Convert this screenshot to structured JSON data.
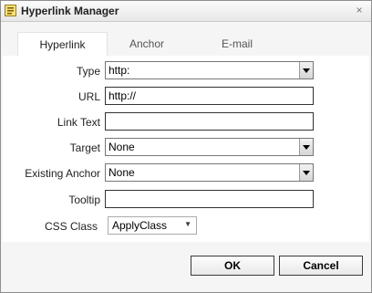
{
  "window": {
    "title": "Hyperlink Manager",
    "close_glyph": "×"
  },
  "tabs": [
    {
      "label": "Hyperlink",
      "active": true
    },
    {
      "label": "Anchor",
      "active": false
    },
    {
      "label": "E-mail",
      "active": false
    }
  ],
  "form": {
    "type": {
      "label": "Type",
      "value": "http:"
    },
    "url": {
      "label": "URL",
      "value": "http://"
    },
    "link_text": {
      "label": "Link Text",
      "value": ""
    },
    "target": {
      "label": "Target",
      "value": "None"
    },
    "existing_anchor": {
      "label": "Existing Anchor",
      "value": "None"
    },
    "tooltip": {
      "label": "Tooltip",
      "value": ""
    },
    "css_class": {
      "label": "CSS Class",
      "value": "ApplyClass"
    }
  },
  "buttons": {
    "ok": "OK",
    "cancel": "Cancel"
  },
  "icons": {
    "window": "hyperlink-manager-icon",
    "close": "close-icon",
    "dropdown": "dropdown-arrow-icon"
  },
  "colors": {
    "panel_bg": "#ffffff",
    "dialog_bg": "#f5f5f5",
    "tab_active_bg": "#ffffff"
  }
}
